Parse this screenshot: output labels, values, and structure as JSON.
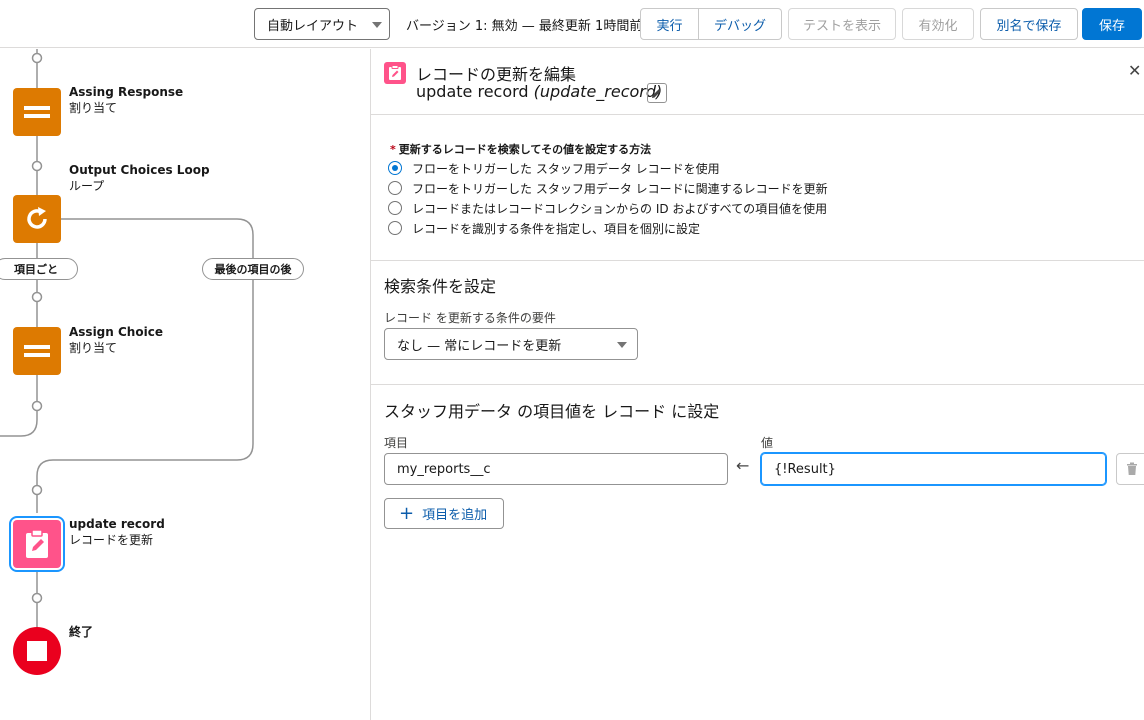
{
  "toolbar": {
    "layout_select": "自動レイアウト",
    "version_status": "バージョン 1: 無効 — 最終更新 1時間前",
    "run": "実行",
    "debug": "デバッグ",
    "view_tests": "テストを表示",
    "activate": "有効化",
    "save_as": "別名で保存",
    "save": "保存"
  },
  "canvas": {
    "nodes": [
      {
        "title": "Assing Response",
        "subtitle": "割り当て",
        "icon": "equals-icon"
      },
      {
        "title": "Output Choices Loop",
        "subtitle": "ループ",
        "icon": "loop-icon"
      },
      {
        "title": "Assign Choice",
        "subtitle": "割り当て",
        "icon": "equals-icon"
      },
      {
        "title": "update record",
        "subtitle": "レコードを更新",
        "icon": "update-record-icon"
      },
      {
        "title": "終了",
        "subtitle": "",
        "icon": "stop-icon"
      }
    ],
    "branch_each": "項目ごと",
    "branch_after_last": "最後の項目の後"
  },
  "panel": {
    "title": "レコードの更新を編集",
    "element_label": "update record",
    "api_name": "(update_record)",
    "method_label": "更新するレコードを検索してその値を設定する方法",
    "options": [
      {
        "label": "フローをトリガーした スタッフ用データ レコードを使用",
        "selected": true
      },
      {
        "label": "フローをトリガーした スタッフ用データ レコードに関連するレコードを更新",
        "selected": false
      },
      {
        "label": "レコードまたはレコードコレクションからの ID およびすべての項目値を使用",
        "selected": false
      },
      {
        "label": "レコードを識別する条件を指定し、項目を個別に設定",
        "selected": false
      }
    ],
    "filter_section_title": "検索条件を設定",
    "condition_label": "レコード を更新する条件の要件",
    "condition_value": "なし — 常にレコードを更新",
    "assign_section_title": "スタッフ用データ の項目値を レコード に設定",
    "field_label": "項目",
    "value_label": "値",
    "field_value": "my_reports__c",
    "value_value": "{!Result}",
    "add_field": "項目を追加"
  },
  "colors": {
    "brand": "#0176d3",
    "assignment": "#dd7a01",
    "record_update": "#ff538a",
    "end": "#ea001e"
  }
}
